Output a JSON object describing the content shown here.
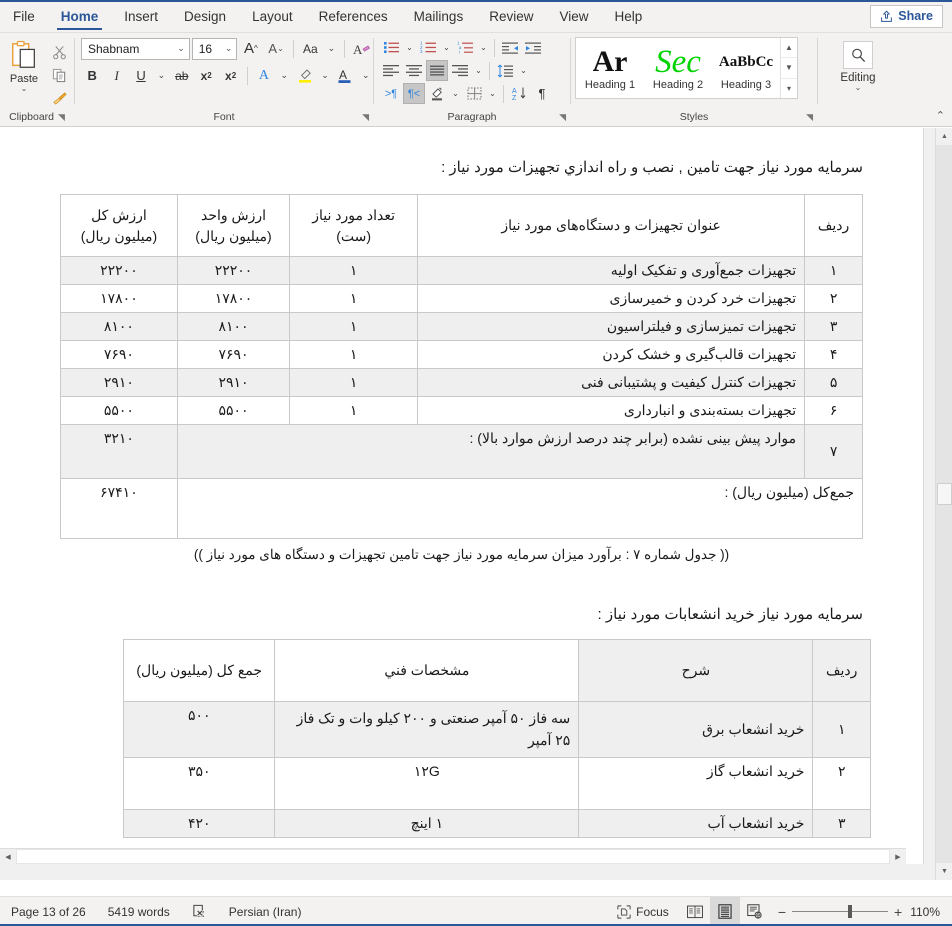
{
  "window": {
    "share_label": "Share"
  },
  "tabs": [
    {
      "label": "File",
      "active": false
    },
    {
      "label": "Home",
      "active": true
    },
    {
      "label": "Insert",
      "active": false
    },
    {
      "label": "Design",
      "active": false
    },
    {
      "label": "Layout",
      "active": false
    },
    {
      "label": "References",
      "active": false
    },
    {
      "label": "Mailings",
      "active": false
    },
    {
      "label": "Review",
      "active": false
    },
    {
      "label": "View",
      "active": false
    },
    {
      "label": "Help",
      "active": false
    }
  ],
  "ribbon": {
    "clipboard": {
      "label": "Clipboard",
      "paste_label": "Paste",
      "icons": [
        "paste-icon",
        "cut-icon",
        "copy-icon",
        "format-painter-icon"
      ]
    },
    "font": {
      "label": "Font",
      "font_name": "Shabnam",
      "font_size": "16",
      "buttons": [
        "grow-font",
        "shrink-font",
        "change-case",
        "clear-formatting",
        "bold",
        "italic",
        "underline",
        "strikethrough",
        "subscript",
        "superscript",
        "text-effects",
        "text-highlight-color",
        "font-color"
      ]
    },
    "paragraph": {
      "label": "Paragraph",
      "buttons": [
        "bullets",
        "numbering",
        "multilevel-list",
        "decrease-indent",
        "increase-indent",
        "align-left",
        "align-center",
        "align-justify",
        "align-right",
        "line-spacing",
        "ltr-text-direction",
        "rtl-text-direction",
        "shading",
        "borders",
        "sort",
        "show-formatting-marks"
      ]
    },
    "styles": {
      "label": "Styles",
      "items": [
        {
          "name": "Heading 1",
          "preview": "Ar"
        },
        {
          "name": "Heading 2",
          "preview": "Sec"
        },
        {
          "name": "Heading 3",
          "preview": "AaBbCc"
        }
      ]
    },
    "editing": {
      "label": "Editing",
      "icon": "search-icon"
    }
  },
  "document": {
    "intro_line_1": "سرمایه مورد نیاز جهت تامین , نصب و راه اندازي تجهیزات مورد نیاز :",
    "table1": {
      "headers": [
        "ردیف",
        "عنوان تجهیزات و دستگاه‌های مورد نیاز",
        "تعداد مورد نیاز (ست)",
        "ارزش واحد (میلیون ریال)",
        "ارزش کل (میلیون ریال)"
      ],
      "rows": [
        {
          "no": "۱",
          "title": "تجهیزات جمع‌آوری و تفکیک اولیه",
          "qty": "۱",
          "unit": "۲۲۲۰۰",
          "total": "۲۲۲۰۰"
        },
        {
          "no": "۲",
          "title": "تجهیزات خرد کردن و خمیرسازی",
          "qty": "۱",
          "unit": "۱۷۸۰۰",
          "total": "۱۷۸۰۰"
        },
        {
          "no": "۳",
          "title": "تجهیزات تمیزسازی و فیلتراسیون",
          "qty": "۱",
          "unit": "۸۱۰۰",
          "total": "۸۱۰۰"
        },
        {
          "no": "۴",
          "title": "تجهیزات قالب‌گیری و خشک کردن",
          "qty": "۱",
          "unit": "۷۶۹۰",
          "total": "۷۶۹۰"
        },
        {
          "no": "۵",
          "title": "تجهیزات کنترل کیفیت و پشتیبانی فنی",
          "qty": "۱",
          "unit": "۲۹۱۰",
          "total": "۲۹۱۰"
        },
        {
          "no": "۶",
          "title": "تجهیزات بسته‌بندی و انبارداری",
          "qty": "۱",
          "unit": "۵۵۰۰",
          "total": "۵۵۰۰"
        },
        {
          "no": "۷",
          "title": "موارد پیش بینی نشده (برابر چند درصد ارزش موارد بالا) :",
          "qty": "",
          "unit": "",
          "total": "۳۲۱۰"
        }
      ],
      "sum_label": "جمع‌کل (میلیون ریال) :",
      "sum_value": "۶۷۴۱۰"
    },
    "caption_1": "(( جدول شماره ۷ : برآورد میزان سرمایه مورد نیاز جهت تامین تجهیزات و دستگاه های مورد نیاز ))",
    "intro_line_2": "سرمایه مورد نیاز خرید انشعابات مورد نیاز :",
    "table2": {
      "headers": [
        "ردیف",
        "شرح",
        "مشخصات فني",
        "جمع کل (میلیون ریال)"
      ],
      "rows": [
        {
          "no": "۱",
          "desc": "خرید انشعاب برق",
          "spec": "سه فاز ۵۰ آمپر صنعتی  و ۲۰۰ کیلو وات و تک فاز ۲۵ آمپر",
          "total": "۵۰۰"
        },
        {
          "no": "۲",
          "desc": "خرید انشعاب گاز",
          "spec": "۱۲G",
          "total": "۳۵۰"
        },
        {
          "no": "۳",
          "desc": "خرید انشعاب آب",
          "spec": "۱ اینچ",
          "total": "۴۲۰"
        }
      ]
    }
  },
  "statusbar": {
    "page": "Page 13 of 26",
    "words": "5419 words",
    "proofing_icon": "proofing-errors-icon",
    "language": "Persian (Iran)",
    "focus": "Focus",
    "views": [
      "read-mode-icon",
      "print-layout-icon",
      "web-layout-icon"
    ],
    "zoom_minus": "−",
    "zoom_plus": "+",
    "zoom_level": "110%"
  },
  "colors": {
    "accent": "#2b579a",
    "ribbon_bg": "#f3f2f1",
    "row_alt": "#efefef",
    "heading2_green": "#00d400"
  }
}
